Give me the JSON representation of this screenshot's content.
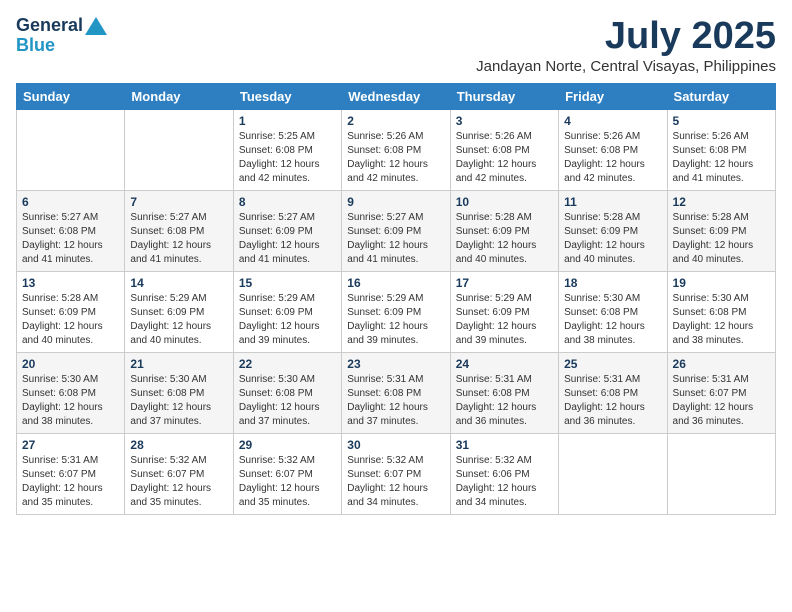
{
  "header": {
    "logo_line1": "General",
    "logo_line2": "Blue",
    "month": "July 2025",
    "location": "Jandayan Norte, Central Visayas, Philippines"
  },
  "days_of_week": [
    "Sunday",
    "Monday",
    "Tuesday",
    "Wednesday",
    "Thursday",
    "Friday",
    "Saturday"
  ],
  "weeks": [
    [
      {
        "num": "",
        "info": ""
      },
      {
        "num": "",
        "info": ""
      },
      {
        "num": "1",
        "info": "Sunrise: 5:25 AM\nSunset: 6:08 PM\nDaylight: 12 hours and 42 minutes."
      },
      {
        "num": "2",
        "info": "Sunrise: 5:26 AM\nSunset: 6:08 PM\nDaylight: 12 hours and 42 minutes."
      },
      {
        "num": "3",
        "info": "Sunrise: 5:26 AM\nSunset: 6:08 PM\nDaylight: 12 hours and 42 minutes."
      },
      {
        "num": "4",
        "info": "Sunrise: 5:26 AM\nSunset: 6:08 PM\nDaylight: 12 hours and 42 minutes."
      },
      {
        "num": "5",
        "info": "Sunrise: 5:26 AM\nSunset: 6:08 PM\nDaylight: 12 hours and 41 minutes."
      }
    ],
    [
      {
        "num": "6",
        "info": "Sunrise: 5:27 AM\nSunset: 6:08 PM\nDaylight: 12 hours and 41 minutes."
      },
      {
        "num": "7",
        "info": "Sunrise: 5:27 AM\nSunset: 6:08 PM\nDaylight: 12 hours and 41 minutes."
      },
      {
        "num": "8",
        "info": "Sunrise: 5:27 AM\nSunset: 6:09 PM\nDaylight: 12 hours and 41 minutes."
      },
      {
        "num": "9",
        "info": "Sunrise: 5:27 AM\nSunset: 6:09 PM\nDaylight: 12 hours and 41 minutes."
      },
      {
        "num": "10",
        "info": "Sunrise: 5:28 AM\nSunset: 6:09 PM\nDaylight: 12 hours and 40 minutes."
      },
      {
        "num": "11",
        "info": "Sunrise: 5:28 AM\nSunset: 6:09 PM\nDaylight: 12 hours and 40 minutes."
      },
      {
        "num": "12",
        "info": "Sunrise: 5:28 AM\nSunset: 6:09 PM\nDaylight: 12 hours and 40 minutes."
      }
    ],
    [
      {
        "num": "13",
        "info": "Sunrise: 5:28 AM\nSunset: 6:09 PM\nDaylight: 12 hours and 40 minutes."
      },
      {
        "num": "14",
        "info": "Sunrise: 5:29 AM\nSunset: 6:09 PM\nDaylight: 12 hours and 40 minutes."
      },
      {
        "num": "15",
        "info": "Sunrise: 5:29 AM\nSunset: 6:09 PM\nDaylight: 12 hours and 39 minutes."
      },
      {
        "num": "16",
        "info": "Sunrise: 5:29 AM\nSunset: 6:09 PM\nDaylight: 12 hours and 39 minutes."
      },
      {
        "num": "17",
        "info": "Sunrise: 5:29 AM\nSunset: 6:09 PM\nDaylight: 12 hours and 39 minutes."
      },
      {
        "num": "18",
        "info": "Sunrise: 5:30 AM\nSunset: 6:08 PM\nDaylight: 12 hours and 38 minutes."
      },
      {
        "num": "19",
        "info": "Sunrise: 5:30 AM\nSunset: 6:08 PM\nDaylight: 12 hours and 38 minutes."
      }
    ],
    [
      {
        "num": "20",
        "info": "Sunrise: 5:30 AM\nSunset: 6:08 PM\nDaylight: 12 hours and 38 minutes."
      },
      {
        "num": "21",
        "info": "Sunrise: 5:30 AM\nSunset: 6:08 PM\nDaylight: 12 hours and 37 minutes."
      },
      {
        "num": "22",
        "info": "Sunrise: 5:30 AM\nSunset: 6:08 PM\nDaylight: 12 hours and 37 minutes."
      },
      {
        "num": "23",
        "info": "Sunrise: 5:31 AM\nSunset: 6:08 PM\nDaylight: 12 hours and 37 minutes."
      },
      {
        "num": "24",
        "info": "Sunrise: 5:31 AM\nSunset: 6:08 PM\nDaylight: 12 hours and 36 minutes."
      },
      {
        "num": "25",
        "info": "Sunrise: 5:31 AM\nSunset: 6:08 PM\nDaylight: 12 hours and 36 minutes."
      },
      {
        "num": "26",
        "info": "Sunrise: 5:31 AM\nSunset: 6:07 PM\nDaylight: 12 hours and 36 minutes."
      }
    ],
    [
      {
        "num": "27",
        "info": "Sunrise: 5:31 AM\nSunset: 6:07 PM\nDaylight: 12 hours and 35 minutes."
      },
      {
        "num": "28",
        "info": "Sunrise: 5:32 AM\nSunset: 6:07 PM\nDaylight: 12 hours and 35 minutes."
      },
      {
        "num": "29",
        "info": "Sunrise: 5:32 AM\nSunset: 6:07 PM\nDaylight: 12 hours and 35 minutes."
      },
      {
        "num": "30",
        "info": "Sunrise: 5:32 AM\nSunset: 6:07 PM\nDaylight: 12 hours and 34 minutes."
      },
      {
        "num": "31",
        "info": "Sunrise: 5:32 AM\nSunset: 6:06 PM\nDaylight: 12 hours and 34 minutes."
      },
      {
        "num": "",
        "info": ""
      },
      {
        "num": "",
        "info": ""
      }
    ]
  ]
}
